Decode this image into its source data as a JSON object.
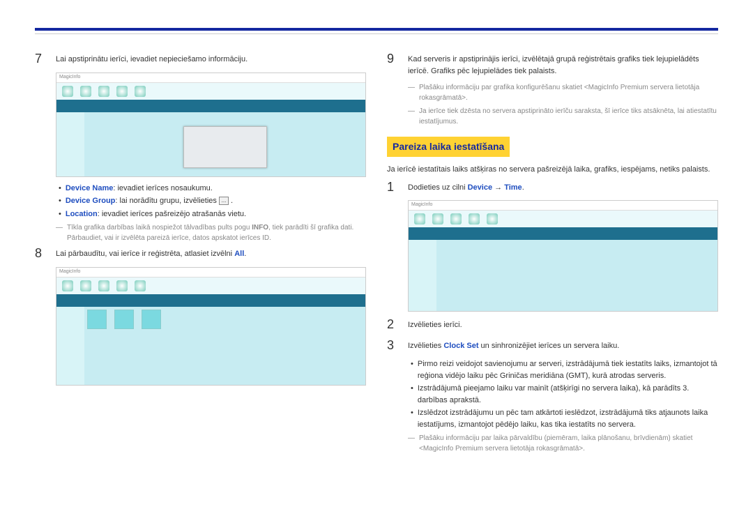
{
  "left": {
    "step7_text": "Lai apstiprinātu ierīci, ievadiet nepieciešamo informāciju.",
    "bullet1_label": "Device Name",
    "bullet1_text": ": ievadiet ierīces nosaukumu.",
    "bullet2_label": "Device Group",
    "bullet2_text": ": lai norādītu grupu, izvēlieties",
    "bullet3_label": "Location",
    "bullet3_text": ": ievadiet ierīces pašreizējo atrašanās vietu.",
    "note1": "Tīkla grafika darbības laikā nospiežot tālvadības pults pogu ",
    "note1_bold": "INFO",
    "note1_rest": ", tiek parādīti šī grafika dati. Pārbaudiet, vai ir izvēlēta pareizā ierīce, datos apskatot ierīces ID.",
    "step8_a": "Lai pārbaudītu, vai ierīce ir reģistrēta, atlasiet izvēlni ",
    "step8_b": "All",
    "step8_c": "."
  },
  "right": {
    "step9_text": "Kad serveris ir apstiprinājis ierīci, izvēlētajā grupā reģistrētais grafiks tiek lejupielādēts ierīcē. Grafiks pēc lejupielādes tiek palaists.",
    "note1": "Plašāku informāciju par grafika konfigurēšanu skatiet <MagicInfo Premium servera lietotāja rokasgrāmatā>.",
    "note2": "Ja ierīce tiek dzēsta no servera apstiprināto ierīču saraksta, šī ierīce tiks atsāknēta, lai atiestatītu iestatījumus.",
    "heading": "Pareiza laika iestatīšana",
    "intro": "Ja ierīcē iestatītais laiks atšķiras no servera pašreizējā laika, grafiks, iespējams, netiks palaists.",
    "step1_a": "Dodieties uz cilni ",
    "step1_b": "Device",
    "step1_arrow": " → ",
    "step1_c": "Time",
    "step1_d": ".",
    "step2_text": "Izvēlieties ierīci.",
    "step3_a": "Izvēlieties ",
    "step3_b": "Clock Set",
    "step3_c": " un sinhronizējiet ierīces un servera laiku.",
    "bullet1": "Pirmo reizi veidojot savienojumu ar serveri, izstrādājumā tiek iestatīts laiks, izmantojot tā reģiona vidējo laiku pēc Griničas meridiāna (GMT), kurā atrodas serveris.",
    "bullet2": "Izstrādājumā pieejamo laiku var mainīt (atšķirīgi no servera laika), kā parādīts 3. darbības aprakstā.",
    "bullet3": "Izslēdzot izstrādājumu un pēc tam atkārtoti ieslēdzot, izstrādājumā tiks atjaunots laika iestatījums, izmantojot pēdējo laiku, kas tika iestatīts no servera.",
    "note3": "Plašāku informāciju par laika pārvaldību (piemēram, laika plānošanu, brīvdienām) skatiet <MagicInfo Premium servera lietotāja rokasgrāmatā>.",
    "num1": "1",
    "num2": "2",
    "num3": "3"
  },
  "nums": {
    "n7": "7",
    "n8": "8",
    "n9": "9"
  },
  "ellipsis": "...",
  "app_name": "MagicInfo"
}
